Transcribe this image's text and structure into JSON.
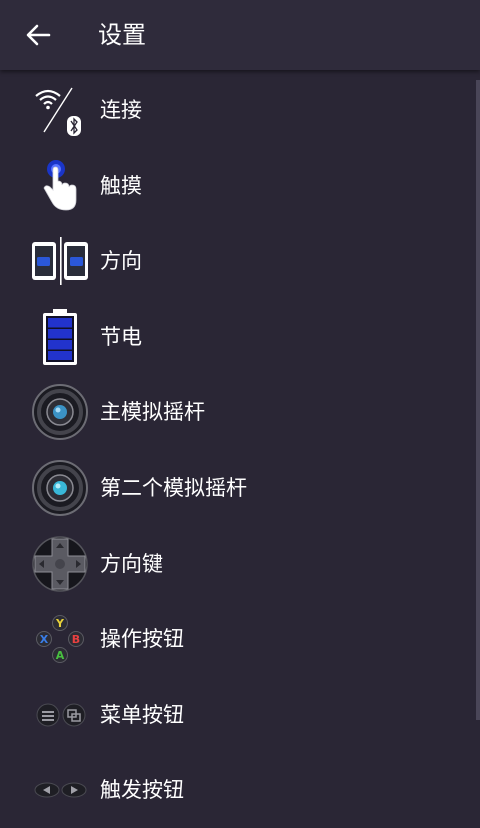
{
  "appbar": {
    "title": "设置",
    "back_icon": "arrow-left-icon"
  },
  "items": [
    {
      "id": "connection",
      "label": "连接",
      "icon": "wifi-bluetooth-icon"
    },
    {
      "id": "touch",
      "label": "触摸",
      "icon": "touch-hand-icon"
    },
    {
      "id": "orientation",
      "label": "方向",
      "icon": "orientation-phones-icon"
    },
    {
      "id": "power",
      "label": "节电",
      "icon": "battery-icon"
    },
    {
      "id": "main-stick",
      "label": "主模拟摇杆",
      "icon": "joystick-icon"
    },
    {
      "id": "second-stick",
      "label": "第二个模拟摇杆",
      "icon": "joystick-icon"
    },
    {
      "id": "dpad",
      "label": "方向键",
      "icon": "dpad-icon"
    },
    {
      "id": "action-buttons",
      "label": "操作按钮",
      "icon": "action-buttons-icon"
    },
    {
      "id": "menu-buttons",
      "label": "菜单按钮",
      "icon": "menu-buttons-icon"
    },
    {
      "id": "trigger-buttons",
      "label": "触发按钮",
      "icon": "trigger-buttons-icon"
    }
  ],
  "colors": {
    "background": "#2a2635",
    "appbar": "#2f2b3b",
    "accent": "#1a35c8"
  }
}
